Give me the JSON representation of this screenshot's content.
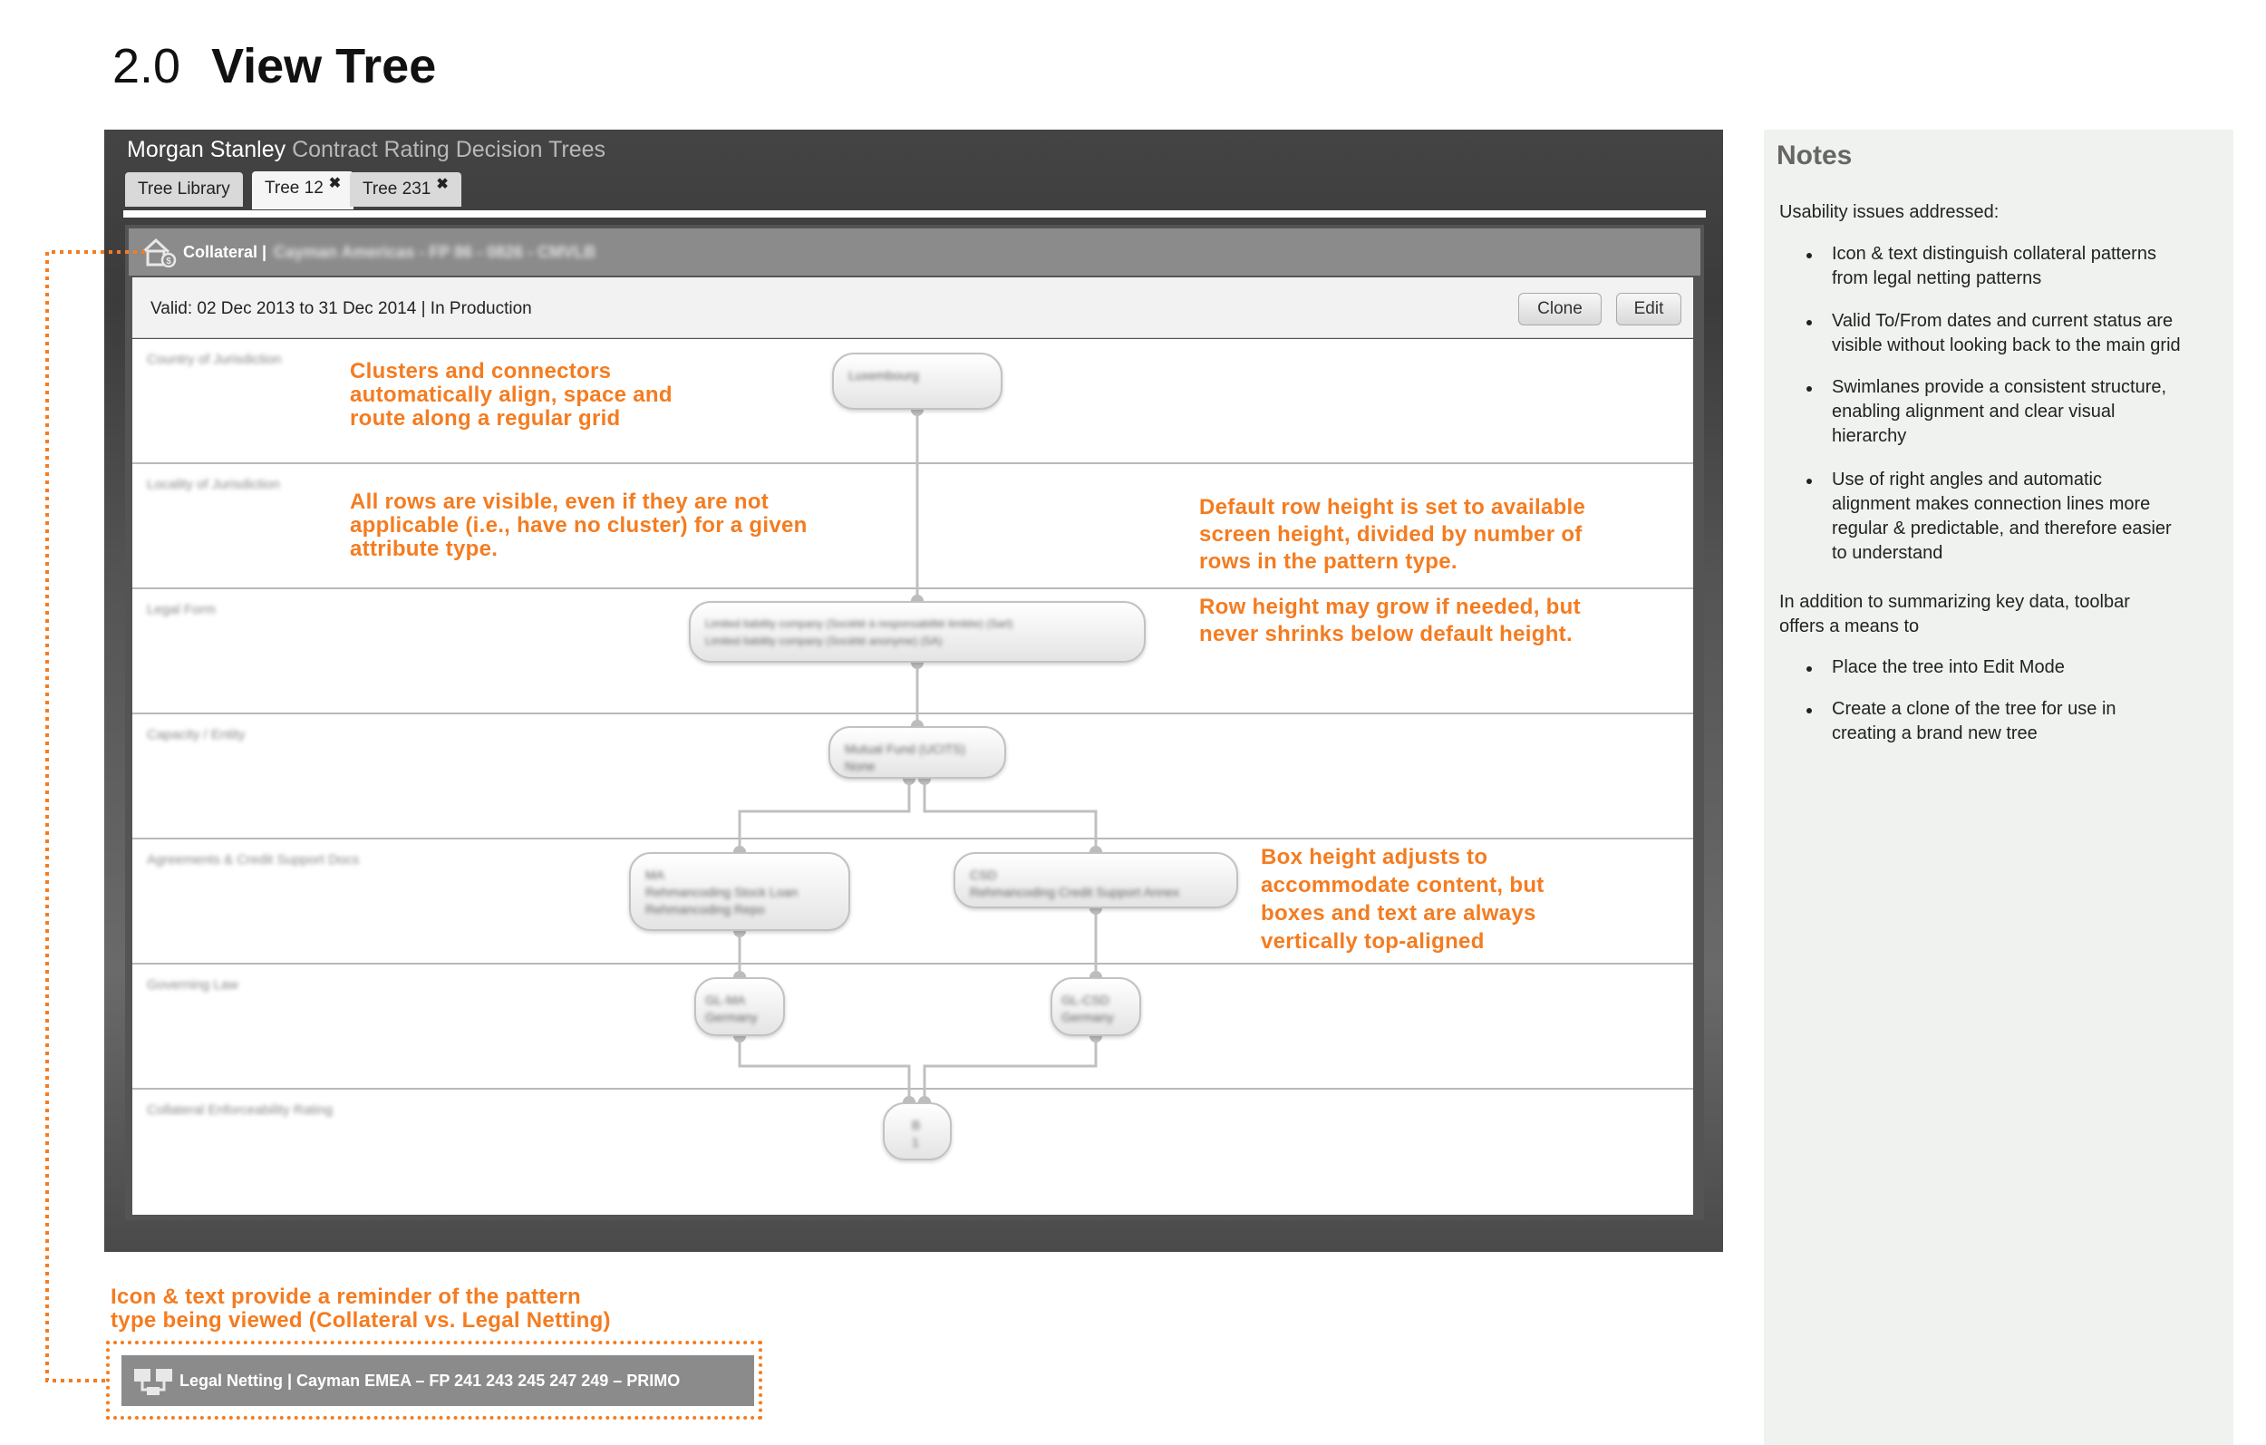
{
  "heading": {
    "number": "2.0",
    "title": "View Tree"
  },
  "app": {
    "brand": "Morgan Stanley",
    "subtitle": "Contract Rating Decision Trees",
    "tabs": [
      {
        "label": "Tree Library",
        "closable": false,
        "active": false
      },
      {
        "label": "Tree 12",
        "closable": true,
        "active": true
      },
      {
        "label": "Tree 231",
        "closable": true,
        "active": false
      }
    ],
    "close_glyph": "✖"
  },
  "pattern_bar": {
    "icon": "collateral-house-icon",
    "type_label": "Collateral |",
    "detail_blurred": "Cayman Americas - FP 86 - 0826 - CMVLB"
  },
  "toolbar": {
    "validity": "Valid: 02 Dec 2013 to 31 Dec 2014  |  In Production",
    "clone_label": "Clone",
    "edit_label": "Edit"
  },
  "swimlanes": [
    {
      "label": "Country of Jurisdiction"
    },
    {
      "label": "Locality of Jurisdiction"
    },
    {
      "label": "Legal Form"
    },
    {
      "label": "Capacity / Entity"
    },
    {
      "label": "Agreements & Credit Support Docs"
    },
    {
      "label": "Governing Law"
    },
    {
      "label": "Collateral Enforceability Rating"
    }
  ],
  "nodes": {
    "luxembourg": [
      "Luxembourg"
    ],
    "legal_form": [
      "Limited liability company (Société à responsabilité limitée) (Sarl)",
      "Limited liability company (Société anonyme) (SA)"
    ],
    "capacity": [
      "Mutual Fund (UCITS)",
      "None"
    ],
    "agreement_left": [
      "MA",
      "Rehmancoding Stock Loan",
      "Rehmancoding Repo"
    ],
    "agreement_right": [
      "CSD",
      "Rehmancoding Credit Support Annex"
    ],
    "law_left": [
      "GL-MA",
      "Germany"
    ],
    "law_right": [
      "GL-CSD",
      "Germany"
    ],
    "rating": [
      "B",
      "1"
    ]
  },
  "annotations": {
    "grid": [
      "Clusters and connectors",
      "automatically align, space and",
      "route along a regular grid"
    ],
    "rows": [
      "All rows are visible, even if they are not",
      "applicable (i.e., have no cluster) for a given",
      "attribute type."
    ],
    "row_height": [
      "Default row height is set to available",
      "screen height, divided by number of",
      "rows in the pattern type."
    ],
    "row_grow": [
      "Row height may grow if needed, but",
      "never shrinks below default height."
    ],
    "box_height": [
      "Box height adjusts to",
      "accommodate content, but",
      "boxes and text are always",
      "vertically top-aligned"
    ],
    "icon_reminder": [
      "Icon & text provide a reminder of the pattern",
      "type being viewed (Collateral vs. Legal Netting)"
    ]
  },
  "legal_netting_bar": {
    "icon": "legal-netting-icon",
    "text": "Legal Netting | Cayman EMEA – FP 241 243 245 247 249 – PRIMO"
  },
  "notes": {
    "title": "Notes",
    "intro": "Usability issues addressed:",
    "issues": [
      [
        "Icon & text distinguish collateral patterns",
        "from legal netting patterns"
      ],
      [
        "Valid To/From dates and current status are",
        "visible without looking back to the main grid"
      ],
      [
        "Swimlanes provide a consistent structure,",
        "enabling alignment and clear visual",
        "hierarchy"
      ],
      [
        "Use of right angles and automatic",
        "alignment makes connection lines more",
        "regular & predictable, and therefore easier",
        "to understand"
      ]
    ],
    "toolbar_intro": [
      "In addition to summarizing key data, toolbar",
      "offers a means to"
    ],
    "toolbar_items": [
      [
        "Place the tree into Edit Mode"
      ],
      [
        "Create a clone of the tree for use in",
        "creating a brand new tree"
      ]
    ]
  },
  "colors": {
    "annotation": "#f47c20",
    "notes_bg": "#f0f2ef",
    "pattern_bar": "#8b8b8b"
  }
}
